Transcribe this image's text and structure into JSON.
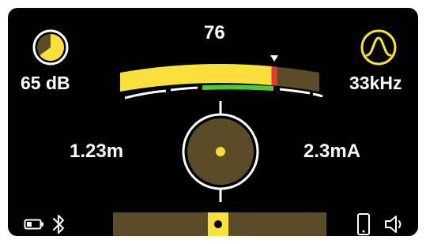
{
  "gain": {
    "value": "76",
    "level_fraction": 0.76
  },
  "volume": {
    "label": "65 dB",
    "fill_fraction": 0.65
  },
  "frequency": {
    "label": "33kHz"
  },
  "depth": {
    "label": "1.23m"
  },
  "current": {
    "label": "2.3mA"
  },
  "signal_bar": {
    "position_fraction": 0.49
  },
  "colors": {
    "accent": "#F9E03B",
    "olive": "#5A4C28",
    "alert_red": "#E53935",
    "green": "#4CCB3A",
    "background": "#000000",
    "text": "#FFFFFF"
  },
  "icons": {
    "volume": "volume-dial-icon",
    "frequency": "frequency-peak-icon",
    "battery": "battery-icon",
    "bluetooth": "bluetooth-icon",
    "phone": "phone-icon",
    "speaker": "speaker-icon"
  }
}
